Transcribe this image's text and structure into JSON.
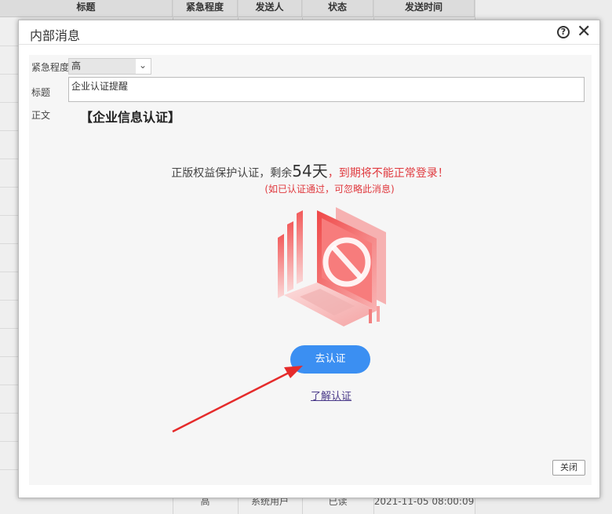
{
  "background_table": {
    "columns": [
      "标题",
      "紧急程度",
      "发送人",
      "状态",
      "发送时间"
    ],
    "last_row": [
      "",
      "高",
      "系统用户",
      "已读",
      "2021-11-05 08:00:09"
    ]
  },
  "dialog": {
    "title": "内部消息",
    "help_icon": "question-circle-icon",
    "close_icon": "close-icon",
    "form": {
      "urgency_label": "紧急程度",
      "urgency_value": "高",
      "title_label": "标题",
      "title_value": "企业认证提醒",
      "body_label": "正文"
    },
    "body": {
      "heading": "【企业信息认证】",
      "notice_prefix": "正版权益保护认证，剩余",
      "days_left": "54天",
      "notice_suffix": "，到期将不能正常登录！",
      "subnote": "(如已认证通过，可忽略此消息)",
      "cta_button": "去认证",
      "learn_link": "了解认证"
    },
    "close_button": "关闭"
  },
  "colors": {
    "accent_blue": "#3b8ff2",
    "warning_red": "#e0393e",
    "arrow_red": "#e52b2b"
  }
}
